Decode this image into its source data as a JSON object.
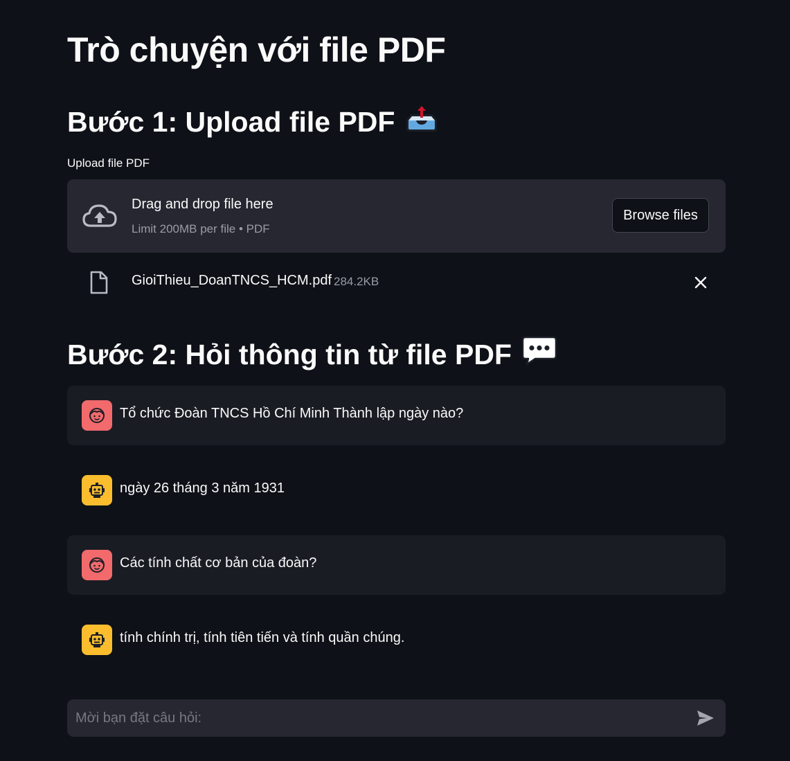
{
  "page": {
    "title": "Trò chuyện với file PDF"
  },
  "step1": {
    "heading": "Bước 1: Upload file PDF",
    "emoji_icon": "outbox-tray-icon"
  },
  "uploader": {
    "label": "Upload file PDF",
    "drag_text": "Drag and drop file here",
    "limit_text": "Limit 200MB per file • PDF",
    "browse_label": "Browse files",
    "file": {
      "name": "GioiThieu_DoanTNCS_HCM.pdf",
      "size": "284.2KB"
    }
  },
  "step2": {
    "heading": "Bước 2: Hỏi thông tin từ file PDF",
    "emoji_icon": "speech-balloon-icon"
  },
  "chat": {
    "messages": [
      {
        "role": "user",
        "avatar_icon": "face-icon",
        "text": "Tổ chức Đoàn TNCS Hồ Chí Minh Thành lập ngày nào?"
      },
      {
        "role": "assistant",
        "avatar_icon": "robot-icon",
        "text": "ngày 26 tháng 3 năm 1931"
      },
      {
        "role": "user",
        "avatar_icon": "face-icon",
        "text": "Các tính chất cơ bản của đoàn?"
      },
      {
        "role": "assistant",
        "avatar_icon": "robot-icon",
        "text": "tính chính trị, tính tiên tiến và tính quần chúng."
      }
    ],
    "input_placeholder": "Mời bạn đặt câu hỏi:"
  },
  "colors": {
    "background": "#0e1117",
    "surface": "#262730",
    "user_message_bg": "#1a1c24",
    "user_avatar": "#f26a6c",
    "assistant_avatar": "#fbbd2e",
    "text": "#fafafa",
    "muted_text": "#9a9ca6"
  }
}
